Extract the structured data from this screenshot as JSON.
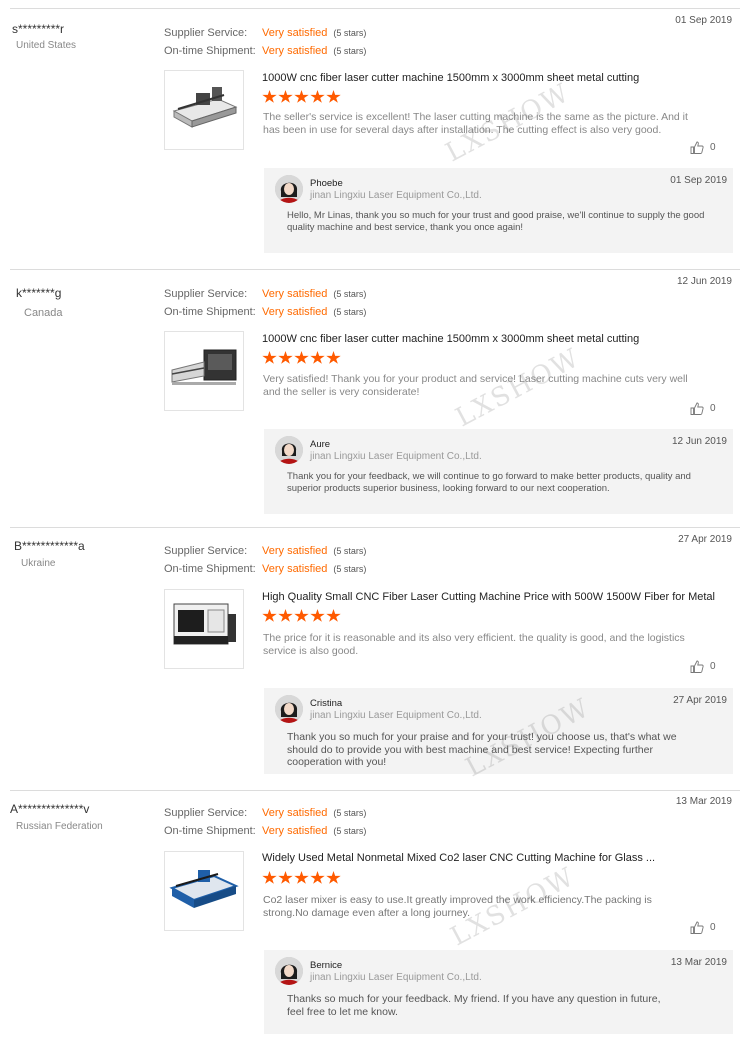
{
  "labels": {
    "supplier_service": "Supplier Service:",
    "on_time_shipment": "On-time Shipment:",
    "stars_text": "(5 stars)"
  },
  "colors": {
    "accent": "#ff6a00",
    "star": "#ff5a00",
    "reply_bg": "#f3f3f3"
  },
  "watermark": "LXSHOW",
  "reviews": [
    {
      "buyer": "s*********r",
      "country": "United States",
      "date": "01 Sep 2019",
      "supplier_service": "Very satisfied",
      "on_time_shipment": "Very satisfied",
      "product_title": "1000W cnc fiber laser cutter machine 1500mm x 3000mm sheet metal cutting",
      "rating_stars": 5,
      "comment": "The seller's service is excellent! The laser cutting machine is the same as the picture. And it has been in use for several days after installation. The cutting effect is also very good.",
      "likes": "0",
      "reply": {
        "name": "Phoebe",
        "company": "jinan Lingxiu Laser Equipment Co.,Ltd.",
        "date": "01 Sep 2019",
        "text": "Hello, Mr Linas, thank you so much for your trust and good praise, we'll continue to supply the good quality machine and best service, thank you once again!"
      }
    },
    {
      "buyer": "k*******g",
      "country": "Canada",
      "date": "12 Jun 2019",
      "supplier_service": "Very satisfied",
      "on_time_shipment": "Very satisfied",
      "product_title": "1000W cnc fiber laser cutter machine 1500mm x 3000mm sheet metal cutting",
      "rating_stars": 5,
      "comment": "Very satisfied! Thank you for your product and service! Laser cutting machine cuts very well and the seller is very considerate!",
      "likes": "0",
      "reply": {
        "name": "Aure",
        "company": "jinan Lingxiu Laser Equipment Co.,Ltd.",
        "date": "12 Jun 2019",
        "text": "Thank you for your feedback, we will continue to go forward to make better products, quality and superior products superior business, looking forward to our next cooperation."
      }
    },
    {
      "buyer": "B************a",
      "country": "Ukraine",
      "date": "27 Apr 2019",
      "supplier_service": "Very satisfied",
      "on_time_shipment": "Very satisfied",
      "product_title": "High Quality Small CNC Fiber Laser Cutting Machine Price with 500W 1500W Fiber for Metal",
      "rating_stars": 5,
      "comment": "The price for it is reasonable and its also very efficient. the quality is good, and the logistics service is also good.",
      "likes": "0",
      "reply": {
        "name": "Cristina",
        "company": "jinan Lingxiu Laser Equipment Co.,Ltd.",
        "date": "27 Apr 2019",
        "text": "Thank you so much for your praise and for your trust! you choose us, that's what we should do to  provide you with best machine and best service! Expecting further cooperation with you!"
      }
    },
    {
      "buyer": "A**************v",
      "country": "Russian Federation",
      "date": "13 Mar 2019",
      "supplier_service": "Very satisfied",
      "on_time_shipment": "Very satisfied",
      "product_title": "Widely Used Metal Nonmetal Mixed Co2 laser CNC Cutting Machine for Glass ...",
      "rating_stars": 5,
      "comment": "Co2 laser mixer is easy to use.It greatly improved the work efficiency.The packing is strong.No damage even after a long journey.",
      "likes": "0",
      "reply": {
        "name": "Bernice",
        "company": "jinan Lingxiu Laser Equipment Co.,Ltd.",
        "date": "13 Mar 2019",
        "text": "Thanks so much for your feedback. My friend. If you have any question in  future, feel free to let me know."
      }
    }
  ]
}
